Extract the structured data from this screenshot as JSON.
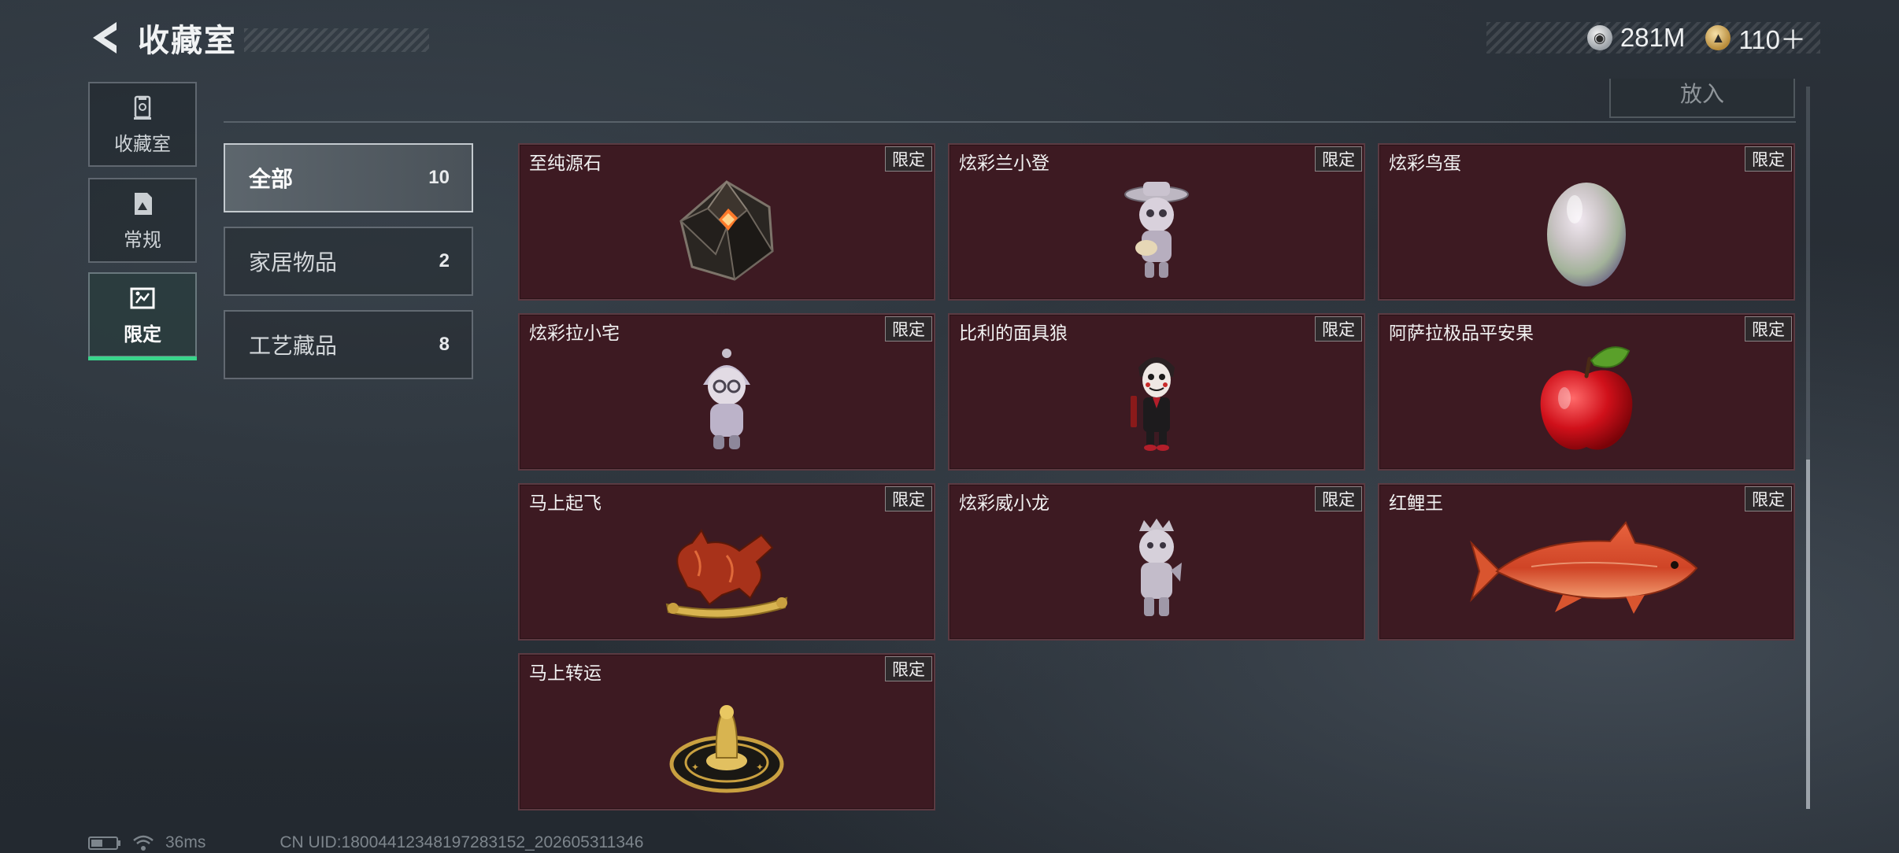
{
  "header": {
    "title": "收藏室",
    "currencies": [
      {
        "icon": "silver-coin-icon",
        "value": "281M"
      },
      {
        "icon": "gold-coin-icon",
        "value": "110＋"
      }
    ]
  },
  "sidebar": {
    "items": [
      {
        "label": "收藏室",
        "icon": "trophy-icon",
        "active": false
      },
      {
        "label": "常规",
        "icon": "document-icon",
        "active": false
      },
      {
        "label": "限定",
        "icon": "frame-icon",
        "active": true
      }
    ]
  },
  "put_button": {
    "label": "放入"
  },
  "filters": [
    {
      "label": "全部",
      "count": "10",
      "active": true
    },
    {
      "label": "家居物品",
      "count": "2",
      "active": false
    },
    {
      "label": "工艺藏品",
      "count": "8",
      "active": false
    }
  ],
  "items": [
    {
      "name": "至纯源石",
      "tag": "限定",
      "icon": "crystal-icon"
    },
    {
      "name": "炫彩兰小登",
      "tag": "限定",
      "icon": "figurine-icon"
    },
    {
      "name": "炫彩鸟蛋",
      "tag": "限定",
      "icon": "egg-icon"
    },
    {
      "name": "炫彩拉小宅",
      "tag": "限定",
      "icon": "figurine-icon"
    },
    {
      "name": "比利的面具狼",
      "tag": "限定",
      "icon": "puppet-icon"
    },
    {
      "name": "阿萨拉极品平安果",
      "tag": "限定",
      "icon": "apple-icon"
    },
    {
      "name": "马上起飞",
      "tag": "限定",
      "icon": "horse-icon"
    },
    {
      "name": "炫彩威小龙",
      "tag": "限定",
      "icon": "figurine-icon"
    },
    {
      "name": "红鲤王",
      "tag": "限定",
      "icon": "fish-icon"
    },
    {
      "name": "马上转运",
      "tag": "限定",
      "icon": "medallion-icon"
    }
  ],
  "status": {
    "ping": "36ms",
    "uid": "CN UID:18004412348197283152_202605311346"
  },
  "colors": {
    "card_bg": "#3d1a22",
    "active_indicator": "#39d58b"
  }
}
